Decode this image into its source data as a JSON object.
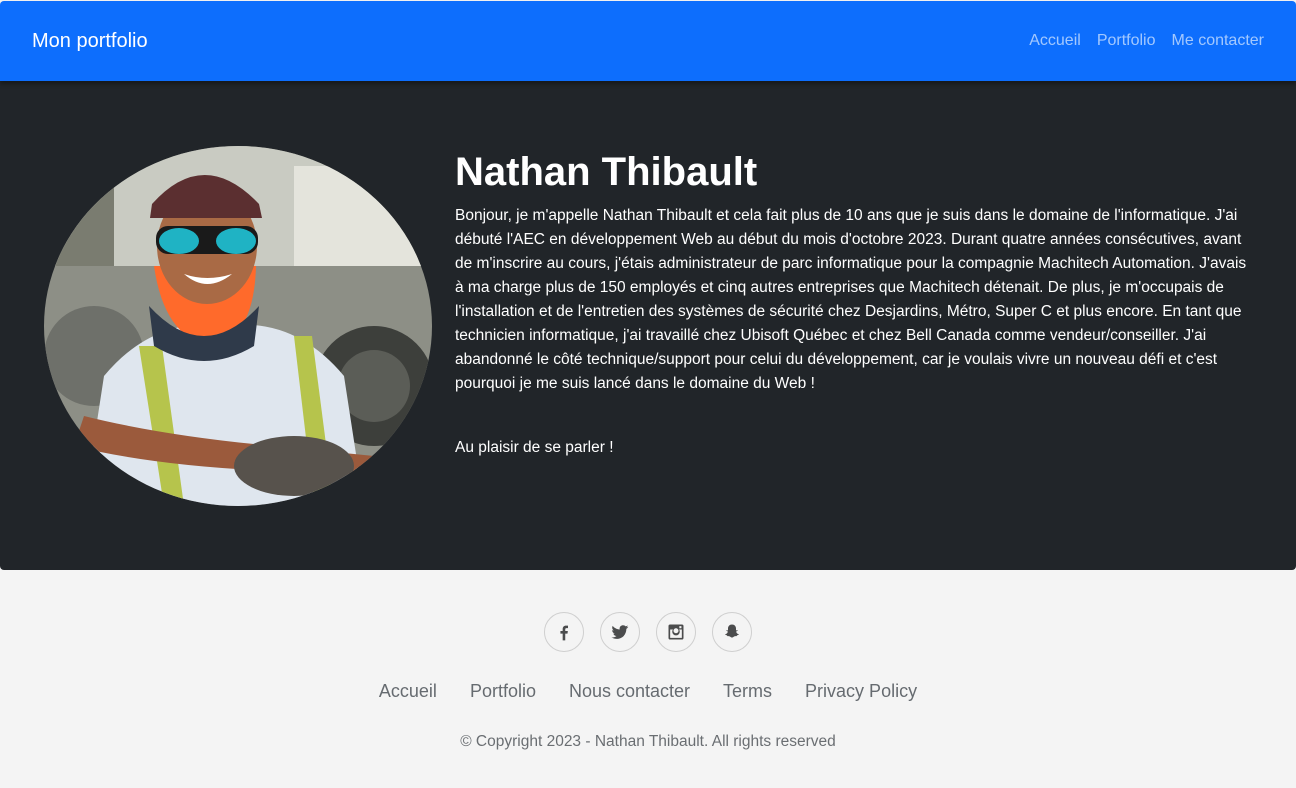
{
  "navbar": {
    "brand": "Mon portfolio",
    "links": [
      "Accueil",
      "Portfolio",
      "Me contacter"
    ],
    "bg_color": "#0d6efd"
  },
  "hero": {
    "name": "Nathan Thibault",
    "bio": "Bonjour, je m'appelle Nathan Thibault et cela fait plus de 10 ans que je suis dans le domaine de l'informatique. J'ai débuté l'AEC en développement Web au début du mois d'octobre 2023. Durant quatre années consécutives, avant de m'inscrire au cours, j'étais administrateur de parc informatique pour la compagnie Machitech Automation. J'avais à ma charge plus de 150 employés et cinq autres entreprises que Machitech détenait. De plus, je m'occupais de l'installation et de l'entretien des systèmes de sécurité chez Desjardins, Métro, Super C et plus encore. En tant que technicien informatique, j'ai travaillé chez Ubisoft Québec et chez Bell Canada comme vendeur/conseiller. J'ai abandonné le côté technique/support pour celui du développement, car je voulais vivre un nouveau défi et c'est pourquoi je me suis lancé dans le domaine du Web !",
    "closing": "Au plaisir de se parler !",
    "bg_color": "#212529"
  },
  "footer": {
    "social_icons": [
      "facebook-icon",
      "twitter-icon",
      "instagram-icon",
      "snapchat-icon"
    ],
    "links": [
      "Accueil",
      "Portfolio",
      "Nous contacter",
      "Terms",
      "Privacy Policy"
    ],
    "copyright": "© Copyright 2023 - Nathan Thibault. All rights reserved",
    "bg_color": "#f4f4f4"
  }
}
